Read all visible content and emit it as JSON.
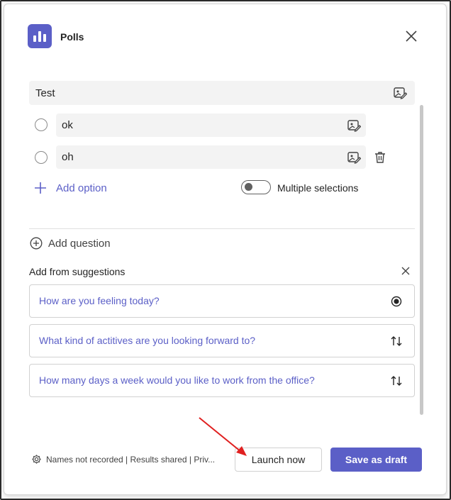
{
  "header": {
    "app_title": "Polls",
    "app_icon": "poll-chart-icon",
    "brand_color": "#5b5fc7"
  },
  "question": {
    "text": "Test",
    "image_icon": "add-image-icon"
  },
  "options": [
    {
      "text": "ok",
      "image_icon": "add-image-icon"
    },
    {
      "text": "oh",
      "image_icon": "add-image-icon",
      "delete_icon": "trash-icon"
    }
  ],
  "add_option_label": "Add option",
  "multiple_selections": {
    "label": "Multiple selections",
    "enabled": false
  },
  "add_question_label": "Add question",
  "suggestions": {
    "heading": "Add from suggestions",
    "items": [
      {
        "text": "How are you feeling today?",
        "icon": "radio-selected-icon"
      },
      {
        "text": "What kind of actitives are you looking forward to?",
        "icon": "sort-arrows-icon"
      },
      {
        "text": "How many days a week would you like to work from the office?",
        "icon": "sort-arrows-icon"
      }
    ]
  },
  "footer": {
    "settings_text": "Names not recorded | Results shared | Priv...",
    "launch_label": "Launch now",
    "draft_label": "Save as draft"
  },
  "annotation_color": "#e02020"
}
